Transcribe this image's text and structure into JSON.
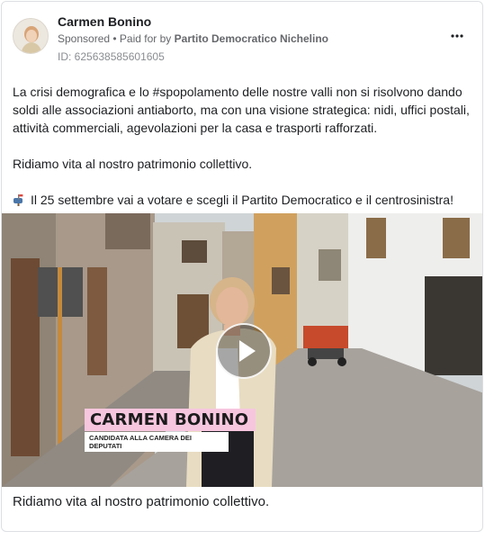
{
  "post": {
    "author": "Carmen Bonino",
    "sponsored_label": "Sponsored",
    "paid_prefix": "• Paid for by",
    "paid_by": "Partito Democratico Nichelino",
    "id_text": "ID: 625638585601605",
    "paragraphs": [
      "La crisi demografica e lo #spopolamento delle nostre valli non si risolvono dando soldi alle associazioni antiaborto, ma con una visione strategica: nidi, uffici postali, attività commerciali, agevolazioni per la casa e trasporti rafforzati.",
      "Ridiamo vita al nostro patrimonio collettivo.",
      "Il 25 settembre vai a votare e scegli il Partito Democratico e il centrosinistra!"
    ],
    "pin_icon": "mailbox-icon",
    "video": {
      "overlay_name": "CARMEN BONINO",
      "overlay_role": "CANDIDATA ALLA CAMERA DEI DEPUTATI"
    },
    "caption": "Ridiamo vita al nostro patrimonio collettivo."
  }
}
